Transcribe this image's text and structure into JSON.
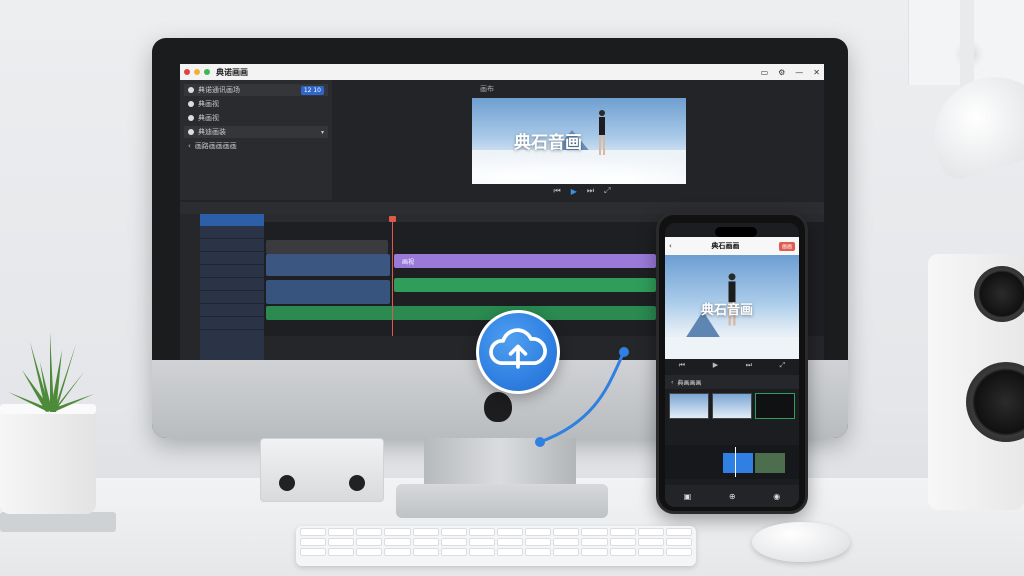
{
  "desktop_app": {
    "window_title": "典诺画画",
    "project_panel": {
      "items": [
        {
          "label": "典诺通讯画场",
          "badge": "12 10"
        },
        {
          "label": "典画视"
        },
        {
          "label": "典画视"
        },
        {
          "label": "典迪画装"
        },
        {
          "label": "画路画画画画"
        }
      ]
    },
    "preview": {
      "header": "画布",
      "overlay_text": "典石音画"
    },
    "timeline": {
      "clip_label": "画视"
    }
  },
  "phone_app": {
    "header_title": "典石画画",
    "header_button": "画画",
    "preview_text": "典石音画",
    "subheader": "典画画画"
  },
  "colors": {
    "accent_blue": "#2f80e2",
    "purple_track": "#9a7ad8",
    "green_track": "#2f9e5a",
    "playhead": "#e0584a"
  },
  "icons": [
    "cloud-upload-icon",
    "play-icon",
    "back-icon"
  ]
}
